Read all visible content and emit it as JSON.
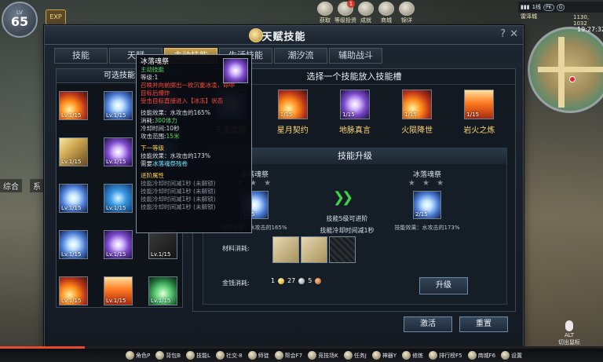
{
  "player": {
    "level_tag": "LV",
    "level": "65",
    "exp_label": "EXP",
    "exp_fraction": 0.14
  },
  "top_menu": [
    {
      "label": "获取",
      "icon": "gift-icon"
    },
    {
      "label": "等级投资",
      "icon": "coin-icon",
      "badge": "1"
    },
    {
      "label": "成就",
      "icon": "trophy-icon"
    },
    {
      "label": "商城",
      "icon": "mall-icon"
    },
    {
      "label": "锦详",
      "icon": "detail-icon"
    }
  ],
  "server": {
    "name": "1线",
    "time": "19:27:32",
    "coords": "1130, 1032",
    "location": "雷泽城",
    "tags": [
      "PK",
      "G"
    ]
  },
  "chat_tabs": [
    "综合",
    "系"
  ],
  "window": {
    "title": "天赋技能",
    "help": "?",
    "close": "✕"
  },
  "tabs": [
    "技能",
    "天赋",
    "主动技能",
    "生活技能",
    "潮汐流",
    "辅助战斗"
  ],
  "left_panel": {
    "title": "可选技能",
    "slots": [
      {
        "lv": "Lv.1/15",
        "icon": "fire-icon",
        "style": "ic-fire"
      },
      {
        "lv": "Lv.1/15",
        "icon": "ice-icon",
        "style": "ic-ice"
      },
      {
        "lv": "Lv.1/15",
        "icon": "swirl-icon",
        "style": "ic-swirl"
      },
      {
        "lv": "Lv.1/15",
        "icon": "wind-icon",
        "style": "ic-wind"
      },
      {
        "lv": "Lv.1/15",
        "icon": "swirl-icon",
        "style": "ic-swirl"
      },
      {
        "lv": "Lv.1/15",
        "icon": "blue-orb-icon",
        "style": "ic-blue"
      },
      {
        "lv": "Lv.1/15",
        "icon": "ice-icon",
        "style": "ic-ice"
      },
      {
        "lv": "Lv.1/15",
        "icon": "ring-icon",
        "style": "ic-blue"
      },
      {
        "lv": "Lv.1/15",
        "icon": "dark-icon",
        "style": "ic-dark"
      },
      {
        "lv": "Lv.1/15",
        "icon": "ice-icon",
        "style": "ic-ice"
      },
      {
        "lv": "Lv.1/15",
        "icon": "swirl-icon",
        "style": "ic-swirl"
      },
      {
        "lv": "Lv.1/15",
        "icon": "dark-icon",
        "style": "ic-dark"
      },
      {
        "lv": "Lv.1/15",
        "icon": "fire-icon",
        "style": "ic-fire"
      },
      {
        "lv": "Lv.1/15",
        "icon": "pillar-icon",
        "style": "ic-pillar"
      },
      {
        "lv": "Lv.1/15",
        "icon": "green-ring-icon",
        "style": "ic-green"
      }
    ]
  },
  "slot_section": {
    "title": "选择一个技能放入技能槽",
    "slots": [
      {
        "name": "天罡雷霆",
        "lv": "1/15",
        "style": "ic-ice"
      },
      {
        "name": "星月契约",
        "lv": "1/15",
        "style": "ic-fire"
      },
      {
        "name": "地脉真言",
        "lv": "1/15",
        "style": "ic-swirl"
      },
      {
        "name": "火陨降世",
        "lv": "1/15",
        "style": "ic-fire"
      },
      {
        "name": "岩火之炼",
        "lv": "1/15",
        "style": "ic-pillar"
      }
    ]
  },
  "upgrade": {
    "title": "技能升级",
    "left": {
      "name": "冰落魂祭",
      "stars": "★ ★ ★",
      "lv": "1/15",
      "effect": "技能效果：水攻击的165%"
    },
    "right": {
      "name": "冰落魂祭",
      "stars": "★ ★ ★",
      "lv": "2/15",
      "effect": "技能效果：水攻击的173%"
    },
    "mid_line1": "技能5级可进阶",
    "mid_line2": "技能冷却时间减1秒",
    "materials_label": "材料消耗:",
    "gold_label": "金钱消耗:",
    "gold": "1",
    "silver": "27",
    "copper": "5",
    "button": "升级"
  },
  "buttons": {
    "activate": "激活",
    "reset": "重置"
  },
  "tooltip": {
    "name": "冰落魂祭",
    "type": "主动技能",
    "level": "等级:1",
    "desc1": "召唤并向前掷出一枚沉重冰凌，命中",
    "desc2": "目标后爆炸",
    "desc3": "受击目标直接进入【冰冻】状态",
    "effect": "技能效果：水攻击的165%",
    "cost_label": "消耗:",
    "cost_value": "300体力",
    "cooldown": "冷却时间:10秒",
    "range_label": "攻击范围:",
    "range_value": "15米",
    "next_title": "下一等级",
    "next_effect": "技能效果：水攻击的173%",
    "next_need_label": "需要",
    "next_need_value": "冰落魂祭残卷",
    "adv_title": "进阶属性",
    "adv1": "技能冷却时间减1秒 (未解锁)",
    "adv2": "技能冷却时间减1秒 (未解锁)",
    "adv3": "技能冷却时间减1秒 (未解锁)",
    "adv4": "技能冷却时间减1秒 (未解锁)"
  },
  "bottom_bar": [
    {
      "label": "角色P",
      "icon": "character-icon"
    },
    {
      "label": "背包B",
      "icon": "bag-icon"
    },
    {
      "label": "技能L",
      "icon": "skill-icon"
    },
    {
      "label": "社交·8",
      "icon": "social-icon"
    },
    {
      "label": "师徒",
      "icon": "mentor-icon"
    },
    {
      "label": "帮会F7",
      "icon": "guild-icon"
    },
    {
      "label": "竞技场K",
      "icon": "arena-icon"
    },
    {
      "label": "任务J",
      "icon": "quest-icon"
    },
    {
      "label": "神器Y",
      "icon": "artifact-icon"
    },
    {
      "label": "修炼",
      "icon": "train-icon"
    },
    {
      "label": "排行榜F5",
      "icon": "rank-icon"
    },
    {
      "label": "商城F6",
      "icon": "shop-icon"
    },
    {
      "label": "设置",
      "icon": "settings-icon"
    }
  ],
  "alt_hint": {
    "key": "ALT",
    "label": "切出鼠标"
  }
}
